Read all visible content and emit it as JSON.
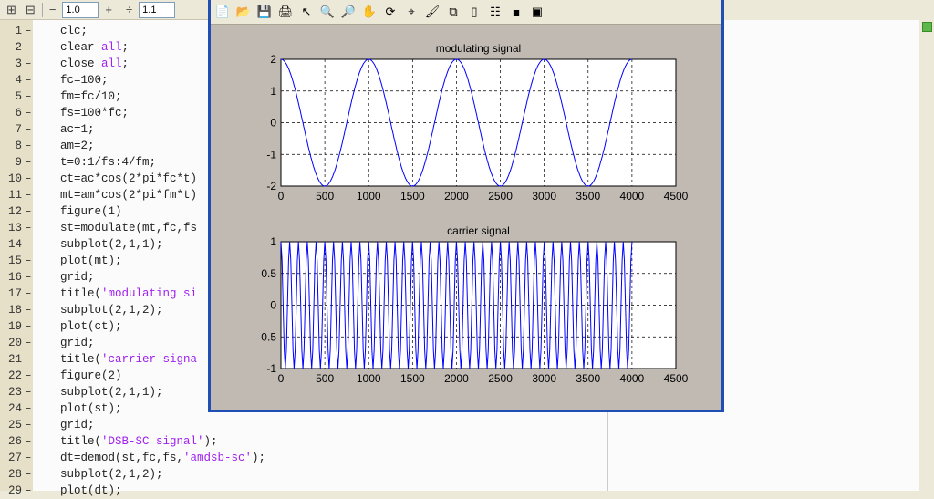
{
  "toolbar": {
    "minus": "−",
    "zoom_value": "1.0",
    "plus": "+",
    "divide": "÷",
    "divide_value": "1.1"
  },
  "editor": {
    "lines": [
      [
        "1",
        "clc;"
      ],
      [
        "2",
        "clear ",
        "all",
        ";"
      ],
      [
        "3",
        "close ",
        "all",
        ";"
      ],
      [
        "4",
        "fc=100;"
      ],
      [
        "5",
        "fm=fc/10;"
      ],
      [
        "6",
        "fs=100*fc;"
      ],
      [
        "7",
        "ac=1;"
      ],
      [
        "8",
        "am=2;"
      ],
      [
        "9",
        "t=0:1/fs:4/fm;"
      ],
      [
        "10",
        "ct=ac*cos(2*pi*fc*t)"
      ],
      [
        "11",
        "mt=am*cos(2*pi*fm*t)"
      ],
      [
        "12",
        "figure(1)"
      ],
      [
        "13",
        "st=modulate(mt,fc,fs"
      ],
      [
        "14",
        "subplot(2,1,1);"
      ],
      [
        "15",
        "plot(mt);"
      ],
      [
        "16",
        "grid;"
      ],
      [
        "17",
        "title(",
        "'modulating si",
        ""
      ],
      [
        "18",
        "subplot(2,1,2);"
      ],
      [
        "19",
        "plot(ct);"
      ],
      [
        "20",
        "grid;"
      ],
      [
        "21",
        "title(",
        "'carrier signa",
        ""
      ],
      [
        "22",
        "figure(2)"
      ],
      [
        "23",
        "subplot(2,1,1);"
      ],
      [
        "24",
        "plot(st);"
      ],
      [
        "25",
        "grid;"
      ],
      [
        "26",
        "title(",
        "'DSB-SC signal'",
        ");"
      ],
      [
        "27",
        "dt=demod(st,fc,fs,",
        "'amdsb-sc'",
        ");"
      ],
      [
        "28",
        "subplot(2,1,2);"
      ],
      [
        "29",
        "plot(dt);"
      ]
    ]
  },
  "chart_data": [
    {
      "type": "line",
      "title": "modulating signal",
      "x_range": [
        0,
        4000
      ],
      "xlim": [
        0,
        4500
      ],
      "ylim": [
        -2,
        2
      ],
      "xticks": [
        "0",
        "500",
        "1000",
        "1500",
        "2000",
        "2500",
        "3000",
        "3500",
        "4000",
        "4500"
      ],
      "yticks": [
        "2",
        "1",
        "0",
        "-1",
        "-2"
      ],
      "amplitude": 2,
      "period": 1000,
      "grid": true,
      "color": "#0000ff"
    },
    {
      "type": "line",
      "title": "carrier signal",
      "x_range": [
        0,
        4000
      ],
      "xlim": [
        0,
        4500
      ],
      "ylim": [
        -1,
        1
      ],
      "xticks": [
        "0",
        "500",
        "1000",
        "1500",
        "2000",
        "2500",
        "3000",
        "3500",
        "4000",
        "4500"
      ],
      "yticks": [
        "1",
        "0.5",
        "0",
        "-0.5",
        "-1"
      ],
      "amplitude": 1,
      "period": 100,
      "grid": true,
      "color": "#0000ff"
    }
  ]
}
